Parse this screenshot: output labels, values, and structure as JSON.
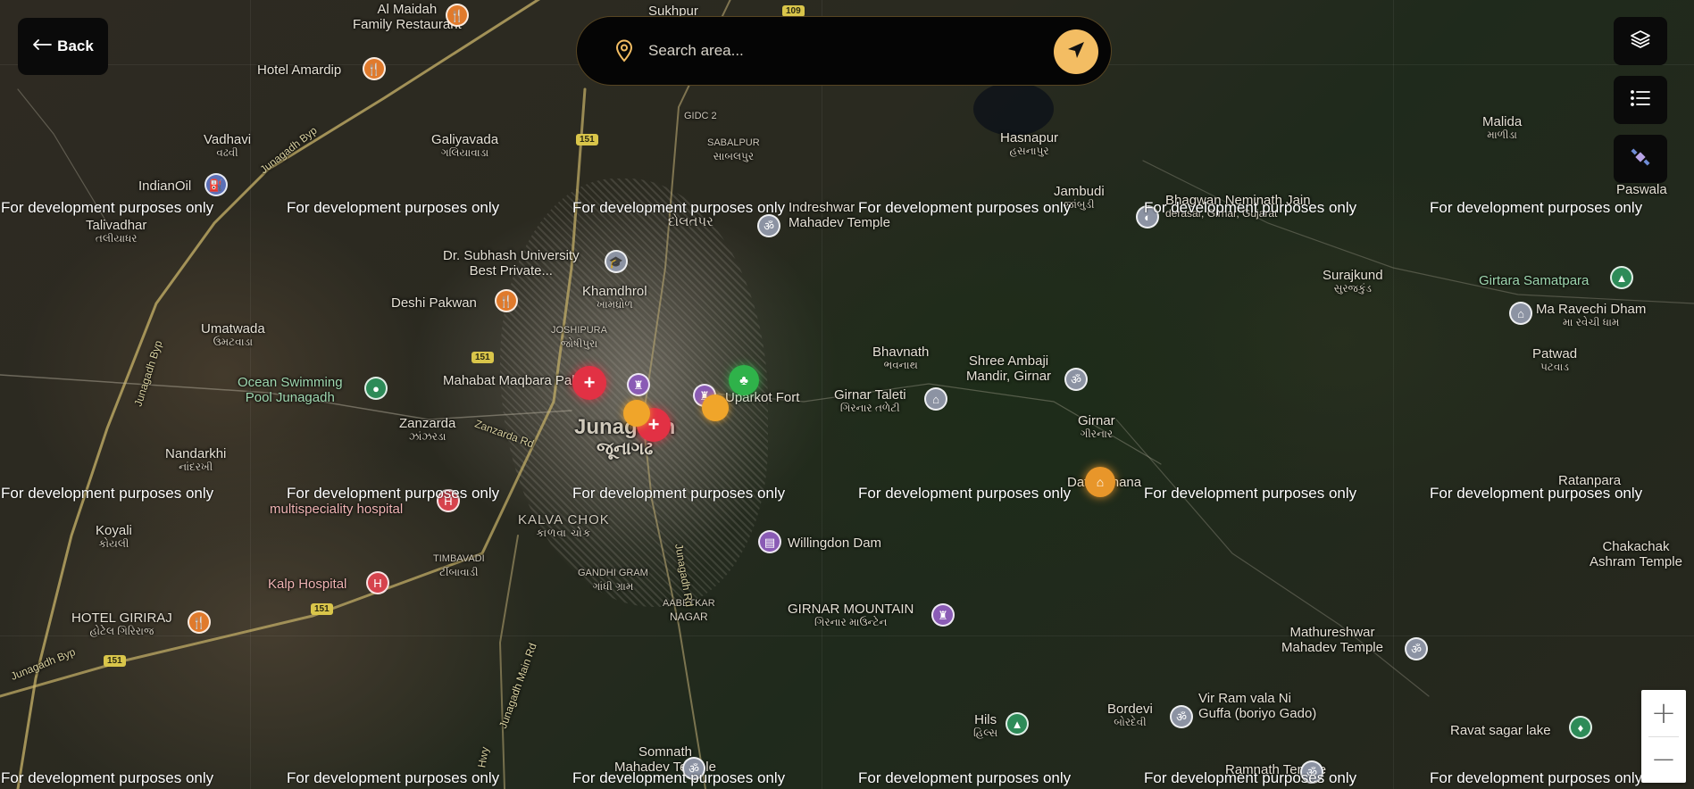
{
  "header": {
    "back_label": "Back",
    "search_placeholder": "Search area..."
  },
  "watermark": "For development purposes only",
  "highways": [
    "151",
    "151",
    "151",
    "151",
    "109"
  ],
  "places": [
    {
      "name": "Al Maidah",
      "sub": "Family Restaurant"
    },
    {
      "name": "Hotel Amardip",
      "sub": ""
    },
    {
      "name": "Vadhavi",
      "sub": "વઢવી"
    },
    {
      "name": "Galiyavada",
      "sub": "ગલિયાવાડા"
    },
    {
      "name": "IndianOil",
      "sub": ""
    },
    {
      "name": "Talivadhar",
      "sub": "તલીયાધર"
    },
    {
      "name": "Dr. Subhash University",
      "sub": "Best Private..."
    },
    {
      "name": "Khamdhrol",
      "sub": "ખામધ્રોળ"
    },
    {
      "name": "Deshi Pakwan",
      "sub": ""
    },
    {
      "name": "Umatwada",
      "sub": "ઉમટવાડા"
    },
    {
      "name": "Ocean Swimming",
      "sub": "Pool Junagadh"
    },
    {
      "name": "Mahabat Maqbara Palace",
      "sub": ""
    },
    {
      "name": "Zanzarda",
      "sub": "ઝાંઝરડા"
    },
    {
      "name": "Nandarkhi",
      "sub": "નાંદરખી"
    },
    {
      "name": "Junagadh",
      "sub": "જૂનાગઢ"
    },
    {
      "name": "multispeciality hospital",
      "sub": ""
    },
    {
      "name": "Koyali",
      "sub": "કોયલી"
    },
    {
      "name": "KALVA CHOK",
      "sub": "કાળવા ચોક"
    },
    {
      "name": "Kalp Hospital",
      "sub": ""
    },
    {
      "name": "HOTEL GIRIRAJ",
      "sub": "હોટેલ ગિરિરાજ"
    },
    {
      "name": "Uparkot Fort",
      "sub": ""
    },
    {
      "name": "Indreshwar",
      "sub": "Mahadev Temple"
    },
    {
      "name": "Hasnapur",
      "sub": "હસનાપુર"
    },
    {
      "name": "Jambudi",
      "sub": "જાંબુડી"
    },
    {
      "name": "Bhagwan Neminath Jain",
      "sub": "derasar, Girnar, Gujarat"
    },
    {
      "name": "Bhavnath",
      "sub": "ભવનાથ"
    },
    {
      "name": "Shree Ambaji",
      "sub": "Mandir, Girnar"
    },
    {
      "name": "Girnar Taleti",
      "sub": "ગિરનાર તળેટી"
    },
    {
      "name": "Girnar",
      "sub": "ગીરનાર"
    },
    {
      "name": "Datar Thana",
      "sub": ""
    },
    {
      "name": "Willingdon Dam",
      "sub": ""
    },
    {
      "name": "GIRNAR MOUNTAIN",
      "sub": "ગિરનાર માઉન્ટેન"
    },
    {
      "name": "Surajkund",
      "sub": "સુરજકુંડ"
    },
    {
      "name": "Malida",
      "sub": "માળીડા"
    },
    {
      "name": "Paswala",
      "sub": ""
    },
    {
      "name": "Girtara Samatpara",
      "sub": ""
    },
    {
      "name": "Ma Ravechi Dham",
      "sub": "મા રવેચી ધામ"
    },
    {
      "name": "Patwad",
      "sub": "પટવાડ"
    },
    {
      "name": "Ratanpara",
      "sub": ""
    },
    {
      "name": "Chakachak",
      "sub": "Ashram Temple"
    },
    {
      "name": "Mathureshwar",
      "sub": "Mahadev Temple"
    },
    {
      "name": "Vir Ram vala Ni",
      "sub": "Guffa (boriyo Gado)"
    },
    {
      "name": "Bordevi",
      "sub": "બોરદેવી"
    },
    {
      "name": "Ravat sagar lake",
      "sub": ""
    },
    {
      "name": "Hils",
      "sub": "હિલ્સ"
    },
    {
      "name": "Somnath",
      "sub": "Mahadev Temple"
    },
    {
      "name": "Ramnath Temple",
      "sub": ""
    },
    {
      "name": "AABETKAR",
      "sub": "NAGAR"
    },
    {
      "name": "GANDHI GRAM",
      "sub": "ગાંધી ગ્રામ"
    },
    {
      "name": "TIMBAVADI",
      "sub": "ટીંબાવાડી"
    },
    {
      "name": "JOSHIPURA",
      "sub": "જોષીપુરા"
    },
    {
      "name": "SABALPUR",
      "sub": "સાબલપુર"
    },
    {
      "name": "Sukhpur",
      "sub": ""
    },
    {
      "name": "Junagadh Byp",
      "sub": ""
    },
    {
      "name": "Junagadh Rd",
      "sub": ""
    },
    {
      "name": "Zanzarda Rd",
      "sub": ""
    },
    {
      "name": "Junagadh Main Rd",
      "sub": ""
    },
    {
      "name": "Hwy",
      "sub": ""
    },
    {
      "name": "Dolatpar",
      "sub": "દોલતપર"
    },
    {
      "name": "GIDC 2",
      "sub": ""
    }
  ]
}
